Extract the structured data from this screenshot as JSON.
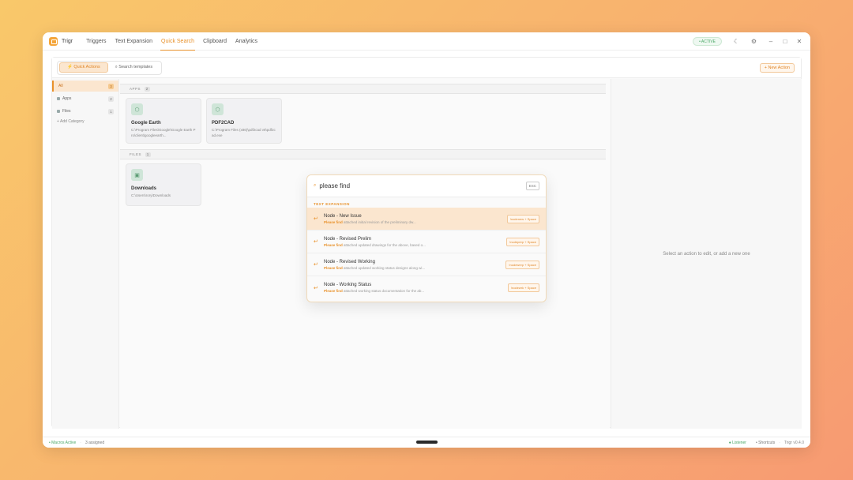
{
  "app": {
    "name": "Trigr",
    "status": "• ACTIVE"
  },
  "nav": {
    "tabs": [
      "Triggers",
      "Text Expansion",
      "Quick Search",
      "Clipboard",
      "Analytics"
    ],
    "active_index": 2
  },
  "toolbar": {
    "quick_actions": "⚡ Quick Actions",
    "search_templates": "⌕ Search templates",
    "new_action": "+ New Action"
  },
  "sidebar": {
    "items": [
      {
        "label": "All",
        "count": "3"
      },
      {
        "label": "Apps",
        "count": "2"
      },
      {
        "label": "Files",
        "count": "1"
      }
    ],
    "add_category": "+ Add Category"
  },
  "sections": {
    "apps": {
      "label": "APPS",
      "count": "2"
    },
    "files": {
      "label": "FILES",
      "count": "1"
    }
  },
  "cards": [
    {
      "title": "Google Earth",
      "path": "C:\\Program Files\\Google\\Google Earth Pro\\client\\googleearth..."
    },
    {
      "title": "PDF2CAD",
      "path": "C:\\Program Files (x86)\\pdf2cad v8\\pdf2cad.exe"
    },
    {
      "title": "Downloads",
      "path": "C:\\Users\\rory\\Downloads"
    }
  ],
  "detail": {
    "placeholder": "Select an action to edit, or add a new one"
  },
  "popup": {
    "query": "please find",
    "esc": "ESC",
    "section": "TEXT EXPANSION",
    "results": [
      {
        "title": "Node - New Issue",
        "highlight": "Please find",
        "desc": " attached initial revision of the preliminary dw...",
        "trigger": "!nodenew + Space"
      },
      {
        "title": "Node - Revised Prelim",
        "highlight": "Please find",
        "desc": " attached updated drawings for the above, based o...",
        "trigger": "!nodeprep + Space"
      },
      {
        "title": "Node - Revised Working",
        "highlight": "Please find",
        "desc": " attached updated working status designs along wi...",
        "trigger": "!nodewrep + Space"
      },
      {
        "title": "Node - Working Status",
        "highlight": "Please find",
        "desc": " attached working status documentation for the ab...",
        "trigger": "!nodewrk + Space"
      }
    ]
  },
  "statusbar": {
    "macros": "• Macros Active",
    "assigned": "3 assigned",
    "listener": "● Listener",
    "shortcuts": "• Shortcuts",
    "version": "Trigr v0.4.0"
  },
  "colors": {
    "accent": "#e8912a",
    "active_green": "#4aa866"
  }
}
